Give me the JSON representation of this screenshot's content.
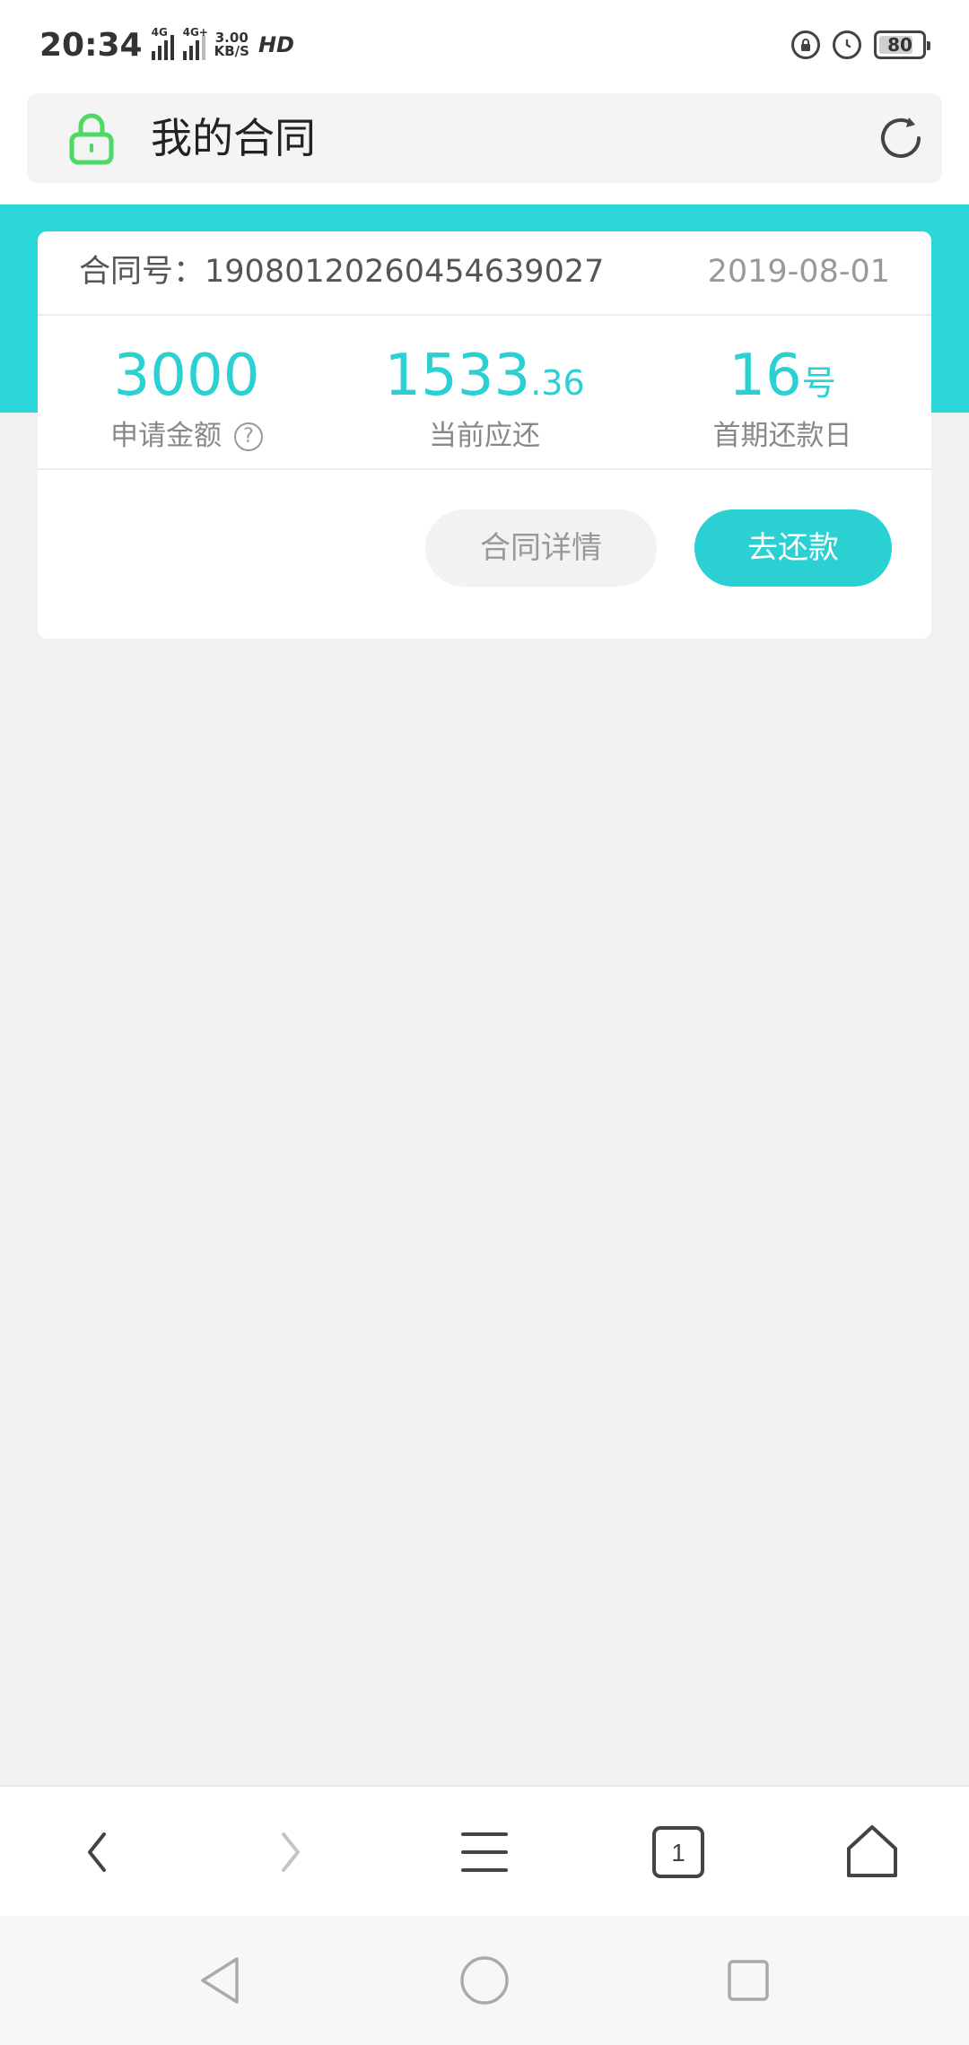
{
  "status_bar": {
    "time": "20:34",
    "network1": "4G",
    "network2": "4G+",
    "speed_value": "3.00",
    "speed_unit": "KB/S",
    "hd_label": "HD",
    "battery": "80"
  },
  "address_bar": {
    "title": "我的合同",
    "lock_color": "#4cd964"
  },
  "contract": {
    "number_label": "合同号：",
    "number": "19080120260454639027",
    "date": "2019-08-01",
    "stats": [
      {
        "value_main": "3000",
        "value_small": "",
        "label": "申请金额",
        "has_help": true
      },
      {
        "value_main": "1533",
        "value_small": ".36",
        "label": "当前应还",
        "has_help": false
      },
      {
        "value_main": "16",
        "value_small": "号",
        "label": "首期还款日",
        "has_help": false
      }
    ],
    "detail_button": "合同详情",
    "repay_button": "去还款",
    "help_glyph": "?"
  },
  "colors": {
    "accent": "#2ad0d2",
    "header_band": "#2ad6d8",
    "background": "#f2f2f2"
  },
  "browser_toolbar": {
    "icons": [
      "back-icon",
      "forward-icon",
      "menu-icon",
      "tabs-icon",
      "home-icon"
    ],
    "tab_count": "1"
  },
  "system_nav": {
    "icons": [
      "nav-back-icon",
      "nav-home-icon",
      "nav-recents-icon"
    ]
  }
}
